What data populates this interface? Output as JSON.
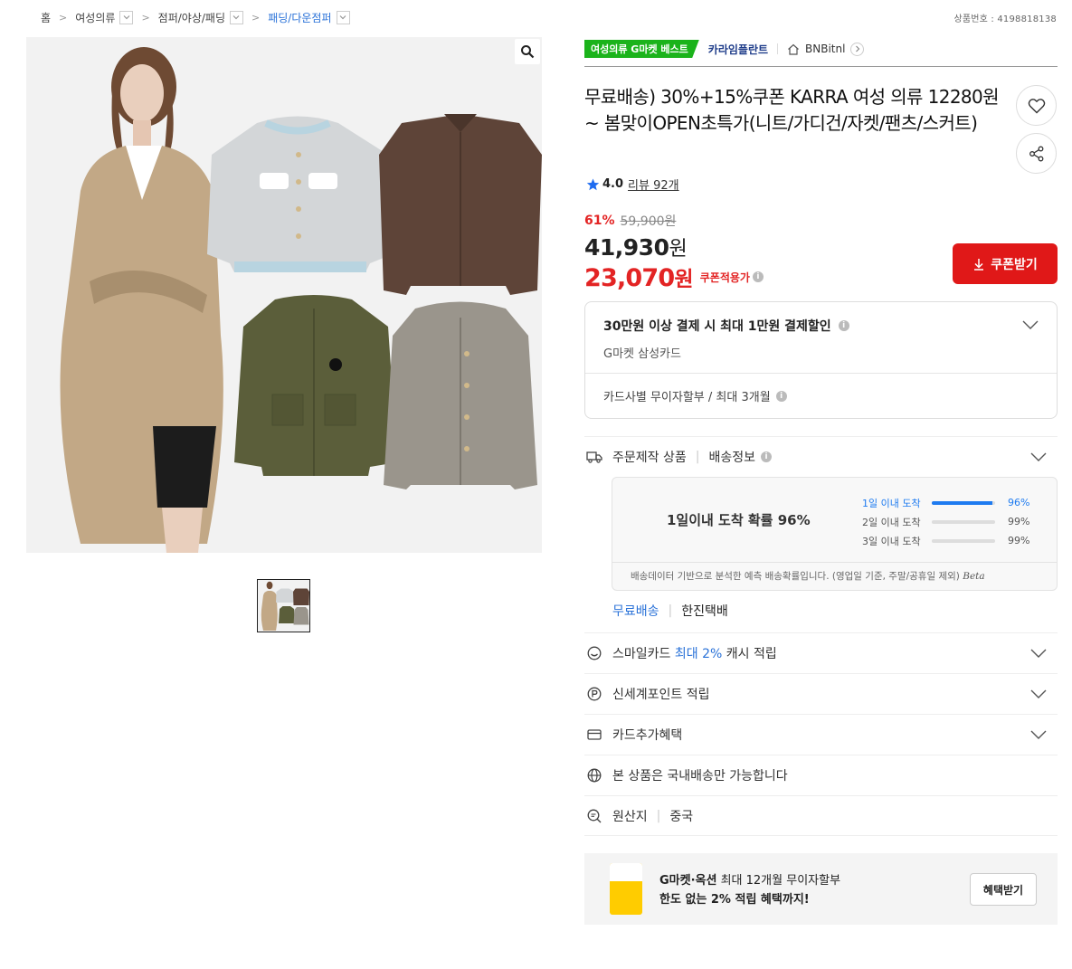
{
  "breadcrumb": {
    "home": "홈",
    "items": [
      {
        "label": "여성의류"
      },
      {
        "label": "점퍼/야상/패딩"
      },
      {
        "label": "패딩/다운점퍼"
      }
    ]
  },
  "product_number": "상품번호 : 4198818138",
  "header": {
    "best_badge": "여성의류 G마켓 베스트",
    "brand": "카라임플란트",
    "shop": "BNBitnl"
  },
  "title": "무료배송) 30%+15%쿠폰 KARRA 여성 의류 12280원~ 봄맞이OPEN초특가(니트/가디건/자켓/팬츠/스커트)",
  "rating": {
    "score": "4.0",
    "review_text": "리뷰 92개"
  },
  "price": {
    "discount_rate": "61%",
    "original": "59,900원",
    "sale_number": "41,930",
    "sale_unit": "원",
    "coupon_number": "23,070",
    "coupon_unit": "원",
    "coupon_note": "쿠폰적용가"
  },
  "coupon_button": "쿠폰받기",
  "card_offer": {
    "headline": "30만원 이상 결제 시 최대 1만원 결제할인",
    "card_name": "G마켓 삼성카드",
    "installment": "카드사별 무이자할부 / 최대 3개월"
  },
  "shipping": {
    "custom_label": "주문제작 상품",
    "info_label": "배송정보",
    "probability_text": "1일이내 도착 확률 96%",
    "rows": [
      {
        "label": "1일 이내 도착",
        "value": "96%",
        "level": 0.96
      },
      {
        "label": "2일 이내 도착",
        "value": "99%",
        "level": 0
      },
      {
        "label": "3일 이내 도착",
        "value": "99%",
        "level": 0
      }
    ],
    "note": "배송데이터 기반으로 분석한 예측 배송확률입니다. (영업일 기준, 주말/공휴일 제외)",
    "beta": "Beta",
    "free": "무료배송",
    "courier": "한진택배"
  },
  "benefits": {
    "smile_prefix": "스마일카드 ",
    "smile_highlight": "최대 2%",
    "smile_suffix": " 캐시 적립",
    "shinsegae": "신세계포인트 적립",
    "card_extra": "카드추가혜택",
    "domestic": "본 상품은 국내배송만 가능합니다",
    "origin_label": "원산지",
    "origin_value": "중국"
  },
  "banner": {
    "brand": "G마켓·옥션",
    "line1_rest": " 최대 12개월 무이자할부",
    "line2": "한도 없는 2% 적립 혜택까지!",
    "button": "혜택받기"
  },
  "colors": {
    "accent_red": "#e01818",
    "link_blue": "#2a72d8",
    "best_green": "#1bb31b"
  }
}
